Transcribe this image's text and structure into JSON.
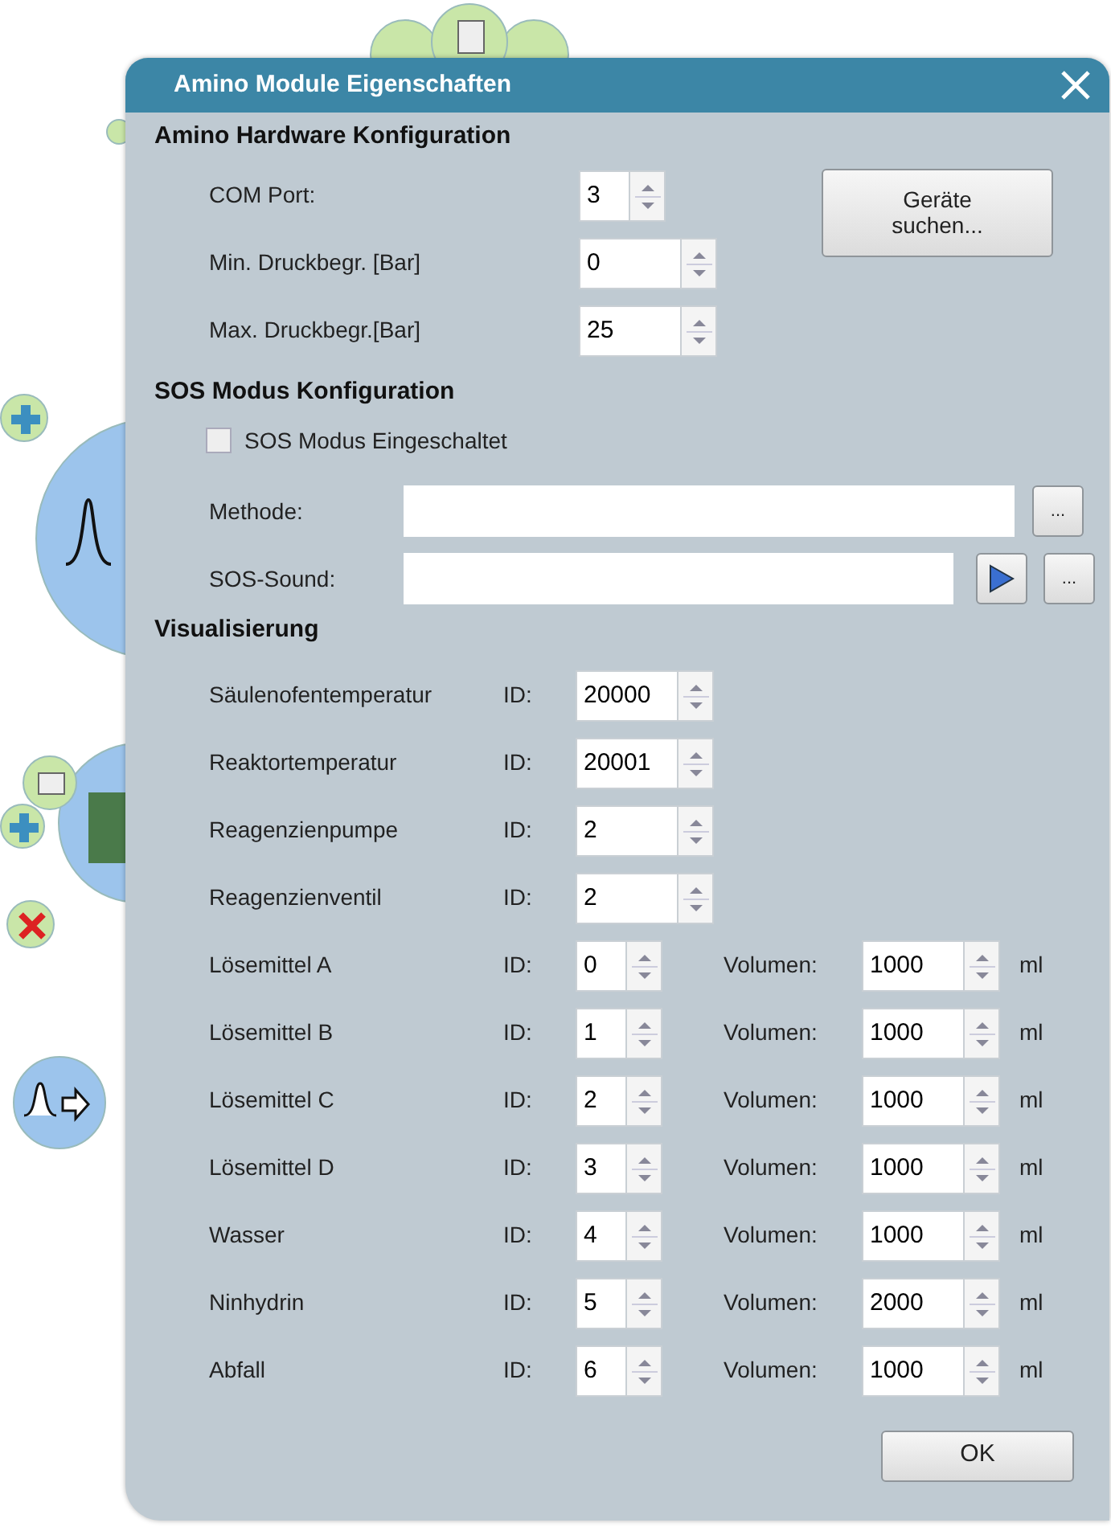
{
  "window": {
    "title": "Amino Module Eigenschaften"
  },
  "hardware": {
    "heading": "Amino Hardware Konfiguration",
    "fields": [
      {
        "label": "COM Port:",
        "value": "3",
        "kind": "narrow"
      },
      {
        "label": "Min. Druckbegr. [Bar]",
        "value": "0",
        "kind": "wide"
      },
      {
        "label": "Max. Druckbegr.[Bar]",
        "value": "25",
        "kind": "wide"
      }
    ],
    "search_button": "Geräte suchen..."
  },
  "sos": {
    "heading": "SOS Modus Konfiguration",
    "checkbox": {
      "label": "SOS Modus Eingeschaltet",
      "checked": false
    },
    "method": {
      "label": "Methode:",
      "browse_button": "..."
    },
    "sound": {
      "label": "SOS-Sound:",
      "browse_button": "..."
    }
  },
  "visualization": {
    "heading": "Visualisierung",
    "rows": [
      {
        "kind": "id",
        "name": "Säulenofentemperatur",
        "id_label": "ID:",
        "id": "20000"
      },
      {
        "kind": "id",
        "name": "Reaktortemperatur",
        "id_label": "ID:",
        "id": "20001"
      },
      {
        "kind": "id",
        "name": "Reagenzienpumpe",
        "id_label": "ID:",
        "id": "2"
      },
      {
        "kind": "id",
        "name": "Reagenzienventil",
        "id_label": "ID:",
        "id": "2"
      },
      {
        "kind": "volume",
        "name": "Lösemittel A",
        "id_label": "ID:",
        "id": "0",
        "volume_label": "Volumen:",
        "volume": "1000",
        "unit": "ml"
      },
      {
        "kind": "volume",
        "name": "Lösemittel B",
        "id_label": "ID:",
        "id": "1",
        "volume_label": "Volumen:",
        "volume": "1000",
        "unit": "ml"
      },
      {
        "kind": "volume",
        "name": "Lösemittel C",
        "id_label": "ID:",
        "id": "2",
        "volume_label": "Volumen:",
        "volume": "1000",
        "unit": "ml"
      },
      {
        "kind": "volume",
        "name": "Lösemittel D",
        "id_label": "ID:",
        "id": "3",
        "volume_label": "Volumen:",
        "volume": "1000",
        "unit": "ml"
      },
      {
        "kind": "volume",
        "name": "Wasser",
        "id_label": "ID:",
        "id": "4",
        "volume_label": "Volumen:",
        "volume": "1000",
        "unit": "ml"
      },
      {
        "kind": "volume",
        "name": "Ninhydrin",
        "id_label": "ID:",
        "id": "5",
        "volume_label": "Volumen:",
        "volume": "2000",
        "unit": "ml"
      },
      {
        "kind": "volume",
        "name": "Abfall",
        "id_label": "ID:",
        "id": "6",
        "volume_label": "Volumen:",
        "volume": "1000",
        "unit": "ml"
      }
    ]
  },
  "ok_button": "OK"
}
